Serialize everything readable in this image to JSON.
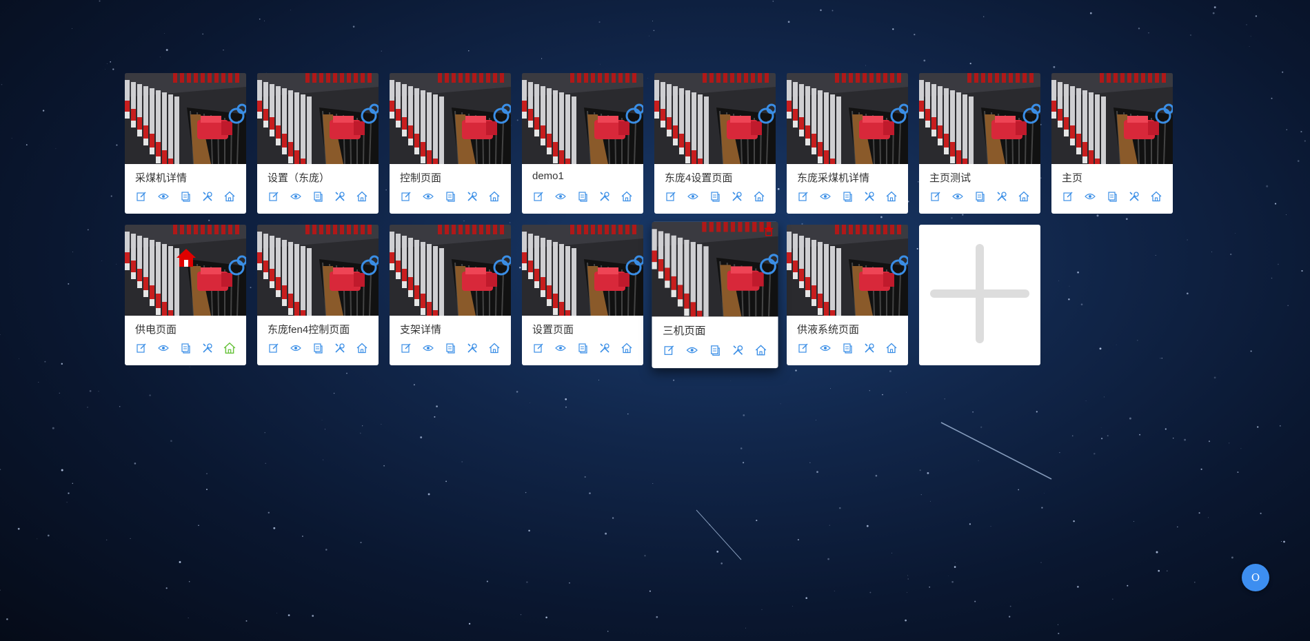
{
  "pages": [
    {
      "name": "采煤机详情"
    },
    {
      "name": "设置（东庞）"
    },
    {
      "name": "控制页面"
    },
    {
      "name": "demo1"
    },
    {
      "name": "东庞4设置页面"
    },
    {
      "name": "东庞采煤机详情"
    },
    {
      "name": "主页测试"
    },
    {
      "name": "主页"
    },
    {
      "name": "供电页面",
      "is_home": true
    },
    {
      "name": "东庞fen4控制页面"
    },
    {
      "name": "支架详情"
    },
    {
      "name": "设置页面"
    },
    {
      "name": "三机页面",
      "hovered": true
    },
    {
      "name": "供液系统页面"
    }
  ],
  "card_actions": [
    "edit-icon",
    "preview-eye-icon",
    "copy-icon",
    "tools-icon",
    "home-icon"
  ],
  "add_card_icon": "plus-icon",
  "float_button": {
    "label": "O",
    "icon": "circle-button"
  },
  "colors": {
    "action_blue": "#3a8ee6",
    "home_active_green": "#67c23a",
    "home_badge_red": "#e00000",
    "float_button": "#3d8ef0",
    "plus_gray": "#dddddd"
  }
}
